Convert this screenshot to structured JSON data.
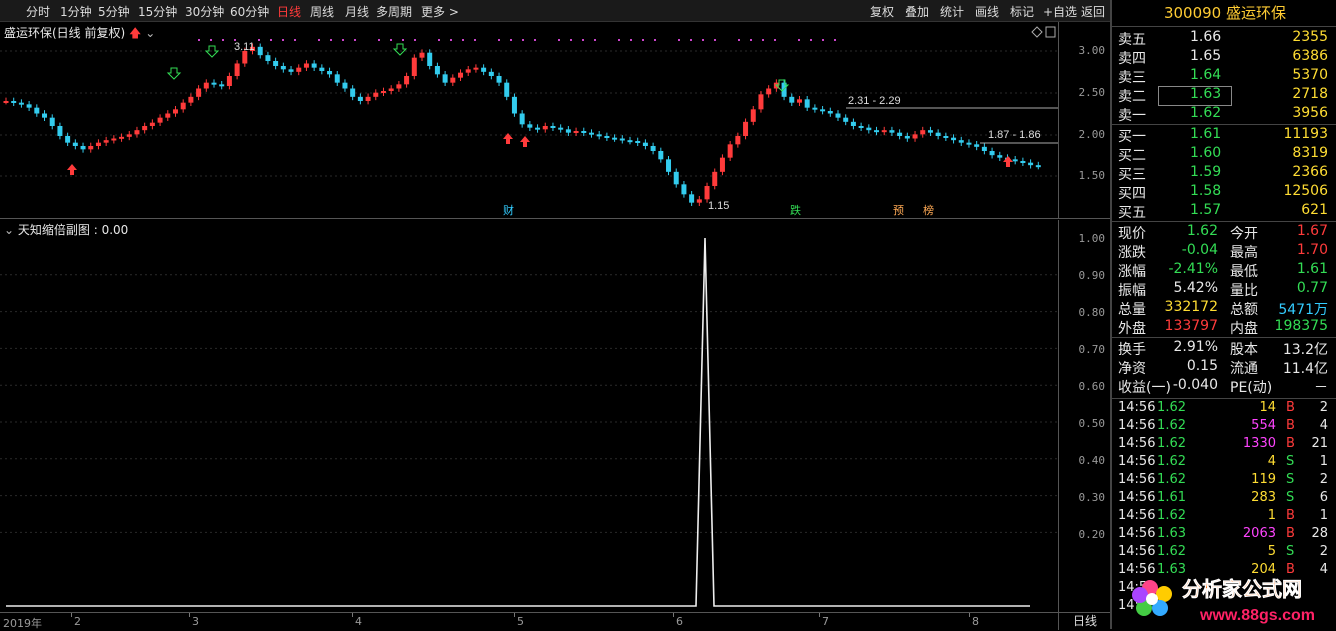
{
  "toolbar": {
    "periods": [
      "分时",
      "1分钟",
      "5分钟",
      "15分钟",
      "30分钟",
      "60分钟",
      "日线",
      "周线",
      "月线",
      "多周期",
      "更多 >"
    ],
    "active": "日线",
    "tools": [
      "复权",
      "叠加",
      "统计",
      "画线",
      "标记",
      "+自选",
      "返回"
    ]
  },
  "main": {
    "title": "盛运环保(日线 前复权)",
    "y_ticks": [
      "3.00",
      "2.50",
      "2.00",
      "1.50"
    ],
    "annotations": {
      "high": "3.11",
      "low": "1.15",
      "range1": "2.31 - 2.29",
      "range2": "1.87 - 1.86"
    },
    "markers": [
      "财",
      "跌",
      "预",
      "榜"
    ]
  },
  "sub": {
    "title": "天知缩倍副图 : 0.00",
    "y_ticks": [
      "1.00",
      "0.90",
      "0.80",
      "0.70",
      "0.60",
      "0.50",
      "0.40",
      "0.30",
      "0.20"
    ]
  },
  "chart_data": {
    "type": "line",
    "title": "天知缩倍副图",
    "ylim": [
      0,
      1.0
    ],
    "series": [
      {
        "name": "天知缩倍副图",
        "peak_value": 1.0,
        "baseline": 0.0
      }
    ]
  },
  "x_axis": {
    "labels": [
      "2019年",
      "2",
      "3",
      "4",
      "5",
      "6",
      "7",
      "8"
    ]
  },
  "period_label": "日线",
  "quote": {
    "code": "300090",
    "name": "盛运环保",
    "asks": [
      {
        "label": "卖五",
        "price": "1.66",
        "vol": "2355"
      },
      {
        "label": "卖四",
        "price": "1.65",
        "vol": "6386"
      },
      {
        "label": "卖三",
        "price": "1.64",
        "vol": "5370"
      },
      {
        "label": "卖二",
        "price": "1.63",
        "vol": "2718"
      },
      {
        "label": "卖一",
        "price": "1.62",
        "vol": "3956"
      }
    ],
    "bids": [
      {
        "label": "买一",
        "price": "1.61",
        "vol": "11193"
      },
      {
        "label": "买二",
        "price": "1.60",
        "vol": "8319"
      },
      {
        "label": "买三",
        "price": "1.59",
        "vol": "2366"
      },
      {
        "label": "买四",
        "price": "1.58",
        "vol": "12506"
      },
      {
        "label": "买五",
        "price": "1.57",
        "vol": "621"
      }
    ],
    "stats": [
      {
        "l1": "现价",
        "v1": "1.62",
        "l2": "今开",
        "v2": "1.67"
      },
      {
        "l1": "涨跌",
        "v1": "-0.04",
        "l2": "最高",
        "v2": "1.70"
      },
      {
        "l1": "涨幅",
        "v1": "-2.41%",
        "l2": "最低",
        "v2": "1.61"
      },
      {
        "l1": "振幅",
        "v1": "5.42%",
        "l2": "量比",
        "v2": "0.77"
      },
      {
        "l1": "总量",
        "v1": "332172",
        "l2": "总额",
        "v2": "5471万"
      },
      {
        "l1": "外盘",
        "v1": "133797",
        "l2": "内盘",
        "v2": "198375"
      }
    ],
    "stats2": [
      {
        "l1": "换手",
        "v1": "2.91%",
        "l2": "股本",
        "v2": "13.2亿"
      },
      {
        "l1": "净资",
        "v1": "0.15",
        "l2": "流通",
        "v2": "11.4亿"
      },
      {
        "l1": "收益(一)",
        "v1": "-0.040",
        "l2": "PE(动)",
        "v2": "－"
      }
    ],
    "ticks": [
      {
        "time": "14:56",
        "price": "1.62",
        "vol": "14",
        "side": "B",
        "n": "2"
      },
      {
        "time": "14:56",
        "price": "1.62",
        "vol": "554",
        "side": "B",
        "n": "4"
      },
      {
        "time": "14:56",
        "price": "1.62",
        "vol": "1330",
        "side": "B",
        "n": "21"
      },
      {
        "time": "14:56",
        "price": "1.62",
        "vol": "4",
        "side": "S",
        "n": "1"
      },
      {
        "time": "14:56",
        "price": "1.62",
        "vol": "119",
        "side": "S",
        "n": "2"
      },
      {
        "time": "14:56",
        "price": "1.61",
        "vol": "283",
        "side": "S",
        "n": "6"
      },
      {
        "time": "14:56",
        "price": "1.62",
        "vol": "1",
        "side": "B",
        "n": "1"
      },
      {
        "time": "14:56",
        "price": "1.63",
        "vol": "2063",
        "side": "B",
        "n": "28"
      },
      {
        "time": "14:56",
        "price": "1.62",
        "vol": "5",
        "side": "S",
        "n": "2"
      },
      {
        "time": "14:56",
        "price": "1.63",
        "vol": "204",
        "side": "B",
        "n": "4"
      }
    ],
    "tick_first_times_truncated": [
      "14:5",
      "14:5"
    ]
  },
  "watermark": {
    "name": "分析家公式网",
    "url": "www.88gs.com"
  },
  "colors": {
    "up": "#ff3b3b",
    "down": "#33ccee",
    "accent": "#ffcc33"
  }
}
